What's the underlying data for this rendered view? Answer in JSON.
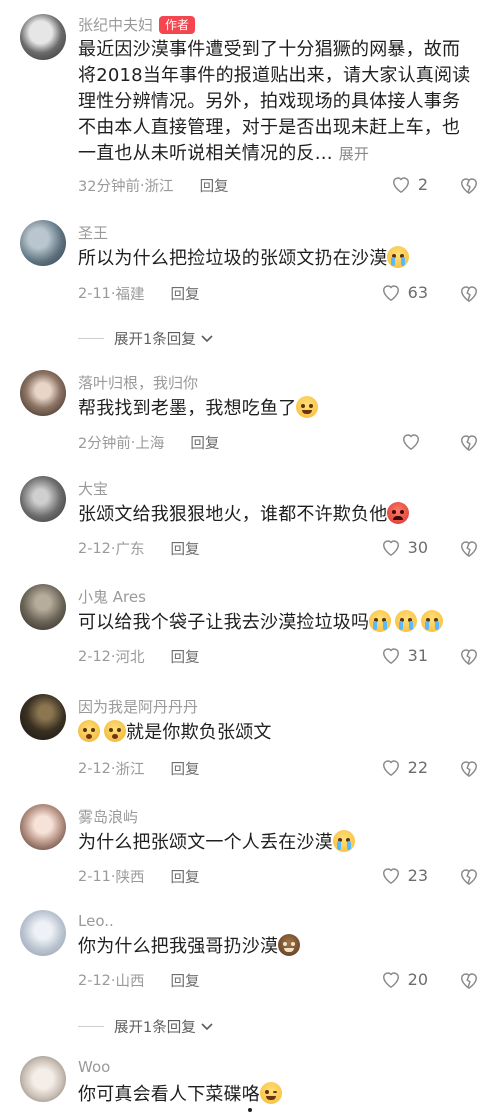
{
  "comments": [
    {
      "nickname": "张纪中夫妇",
      "author_tag": "作者",
      "text": "最近因沙漠事件遭受到了十分猖獗的网暴，故而将2018当年事件的报道贴出来，请大家认真阅读理性分辨情况。另外，拍戏现场的具体接人事务不由本人直接管理，对于是否出现未赶上车，也一直也从未听说相关情况的反…",
      "expand": "展开",
      "time": "32分钟前",
      "location": "浙江",
      "reply": "回复",
      "likes": "2",
      "avatar_colors": [
        "#d9d9d9",
        "#5a5a5a"
      ]
    },
    {
      "nickname": "圣王",
      "text": "所以为什么把捡垃圾的张颂文扔在沙漠",
      "emojis": [
        "cry-emoji"
      ],
      "time": "2-11",
      "location": "福建",
      "reply": "回复",
      "likes": "63",
      "avatar_colors": [
        "#7a8f9c",
        "#2f3c45"
      ]
    },
    {
      "nickname": "落叶归根，我归你",
      "text": "帮我找到老墨，我想吃鱼了",
      "emojis": [
        "laugh-emoji"
      ],
      "time": "2分钟前",
      "location": "上海",
      "reply": "回复",
      "likes": "",
      "avatar_colors": [
        "#c9b7a6",
        "#3a2d26"
      ]
    },
    {
      "nickname": "大宝",
      "text": "张颂文给我狠狠地火，谁都不许欺负他",
      "emojis": [
        "angry-emoji"
      ],
      "time": "2-12",
      "location": "广东",
      "reply": "回复",
      "likes": "30",
      "avatar_colors": [
        "#9c9c9c",
        "#3d3d3d"
      ]
    },
    {
      "nickname": "小鬼 Ares",
      "text": "可以给我个袋子让我去沙漠捡垃圾吗",
      "emojis": [
        "cry-emoji",
        "cry-emoji",
        "cry-emoji"
      ],
      "time": "2-12",
      "location": "河北",
      "reply": "回复",
      "likes": "31",
      "avatar_colors": [
        "#8a8275",
        "#2b2822"
      ]
    },
    {
      "nickname": "因为我是阿丹丹丹",
      "text": "就是你欺负张颂文",
      "emojis_before": [
        "dizzy-emoji",
        "dizzy-emoji"
      ],
      "time": "2-12",
      "location": "浙江",
      "reply": "回复",
      "likes": "22",
      "avatar_colors": [
        "#6b5a3a",
        "#141210"
      ]
    },
    {
      "nickname": "雾岛浪屿",
      "text": "为什么把张颂文一个人丢在沙漠",
      "emojis": [
        "cry-emoji"
      ],
      "time": "2-11",
      "location": "陕西",
      "reply": "回复",
      "likes": "23",
      "avatar_colors": [
        "#efd3c8",
        "#3a2a26"
      ]
    },
    {
      "nickname": "Leo..",
      "text": "你为什么把我强哥扔沙漠",
      "emojis": [
        "cookie-emoji"
      ],
      "time": "2-12",
      "location": "山西",
      "reply": "回复",
      "likes": "20",
      "avatar_colors": [
        "#dde3ea",
        "#9aa6b4"
      ]
    },
    {
      "nickname": "Woo",
      "text": "你可真会看人下菜碟咯",
      "emojis": [
        "wink-emoji"
      ],
      "time": "",
      "location": "",
      "reply": "",
      "likes": "",
      "avatar_colors": [
        "#ece5de",
        "#6b6b6b"
      ]
    }
  ],
  "expand_replies": [
    {
      "label": "展开1条回复"
    },
    {
      "label": "展开1条回复"
    }
  ],
  "colors": {
    "author_tag": "#f5464f",
    "nickname": "#9a9a9a",
    "meta": "#9a9a9a",
    "text": "#1f1f1f"
  }
}
